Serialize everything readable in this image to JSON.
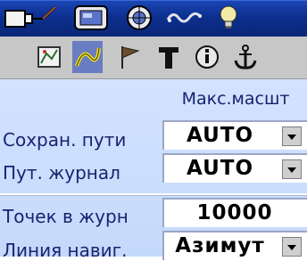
{
  "top_tabs": [
    {
      "icon": "device-plug-icon"
    },
    {
      "icon": "display-icon"
    },
    {
      "icon": "sun-globe-icon"
    },
    {
      "icon": "track-wave-icon"
    },
    {
      "icon": "lightbulb-icon"
    }
  ],
  "sub_tabs": [
    {
      "icon": "map-general-icon",
      "selected": false
    },
    {
      "icon": "tracks-icon",
      "selected": true
    },
    {
      "icon": "flag-icon",
      "selected": false
    },
    {
      "icon": "text-icon",
      "selected": false
    },
    {
      "icon": "info-icon",
      "selected": false
    },
    {
      "icon": "anchor-icon",
      "selected": false
    }
  ],
  "settings": {
    "column_header": "Макс.масшт",
    "rows": [
      {
        "label": "Сохран. пути",
        "value": "AUTO"
      },
      {
        "label": "Пут. журнал",
        "value": "AUTO"
      },
      {
        "label": "Точек в журн",
        "value": "10000"
      },
      {
        "label": "Линия навиг.",
        "value": "Азимут"
      }
    ]
  },
  "colors": {
    "top_bar": "#0c2f8d",
    "sub_bar": "#c7c7c7",
    "selected_tab": "#6a7dc2",
    "panel": "#c4d9fb",
    "label_text": "#1b2370"
  }
}
